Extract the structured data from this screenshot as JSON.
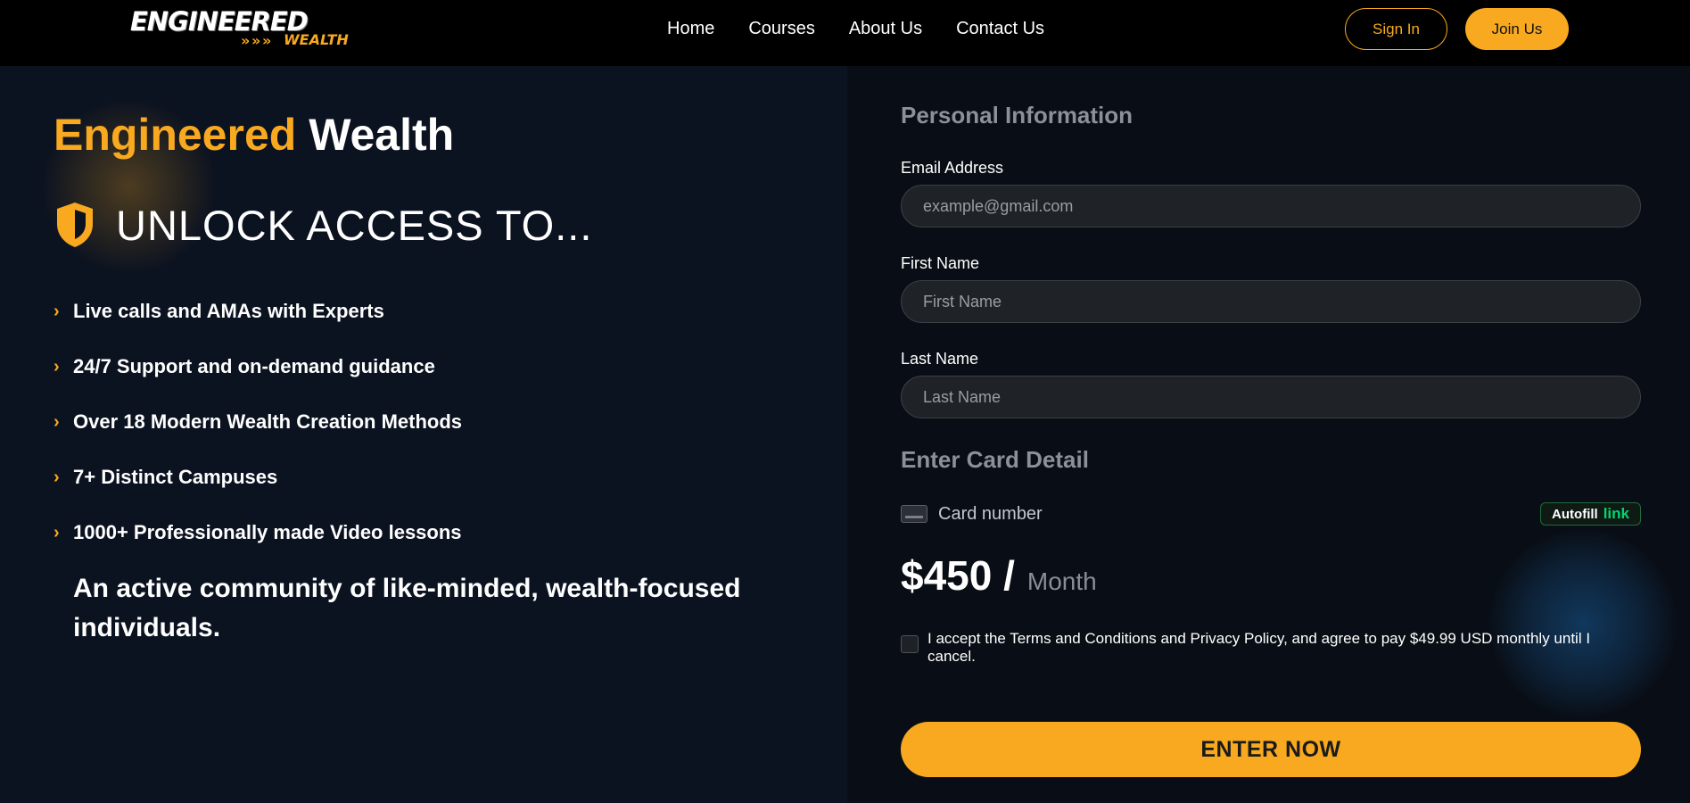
{
  "header": {
    "logo": {
      "top": "ENGINEERED",
      "bottom": "WEALTH"
    },
    "nav": [
      {
        "label": "Home"
      },
      {
        "label": "Courses"
      },
      {
        "label": "About Us"
      },
      {
        "label": "Contact Us"
      }
    ],
    "sign_in_label": "Sign In",
    "join_label": "Join Us"
  },
  "hero": {
    "title_accent": "Engineered",
    "title_main": "Wealth",
    "unlock_text": "UNLOCK ACCESS TO...",
    "features": [
      "Live calls and AMAs with Experts",
      "24/7 Support and on-demand guidance",
      "Over 18 Modern Wealth Creation Methods",
      "7+ Distinct Campuses",
      "1000+ Professionally made Video lessons"
    ],
    "community_text": "An active community of like-minded, wealth-focused individuals."
  },
  "form": {
    "personal_title": "Personal Information",
    "email": {
      "label": "Email Address",
      "placeholder": "example@gmail.com"
    },
    "first_name": {
      "label": "First Name",
      "placeholder": "First Name"
    },
    "last_name": {
      "label": "Last Name",
      "placeholder": "Last Name"
    },
    "card_title": "Enter Card Detail",
    "card_number_label": "Card number",
    "autofill_label": "Autofill",
    "autofill_link": "link",
    "price_amount": "$450 /",
    "price_period": "Month",
    "terms_text": "I accept the Terms and Conditions and Privacy Policy, and agree to pay $49.99 USD monthly until I cancel.",
    "submit_label": "ENTER NOW"
  },
  "colors": {
    "accent": "#f8a91f",
    "header_bg": "#000000",
    "page_bg": "#0b1220",
    "link_green": "#00d66f"
  }
}
